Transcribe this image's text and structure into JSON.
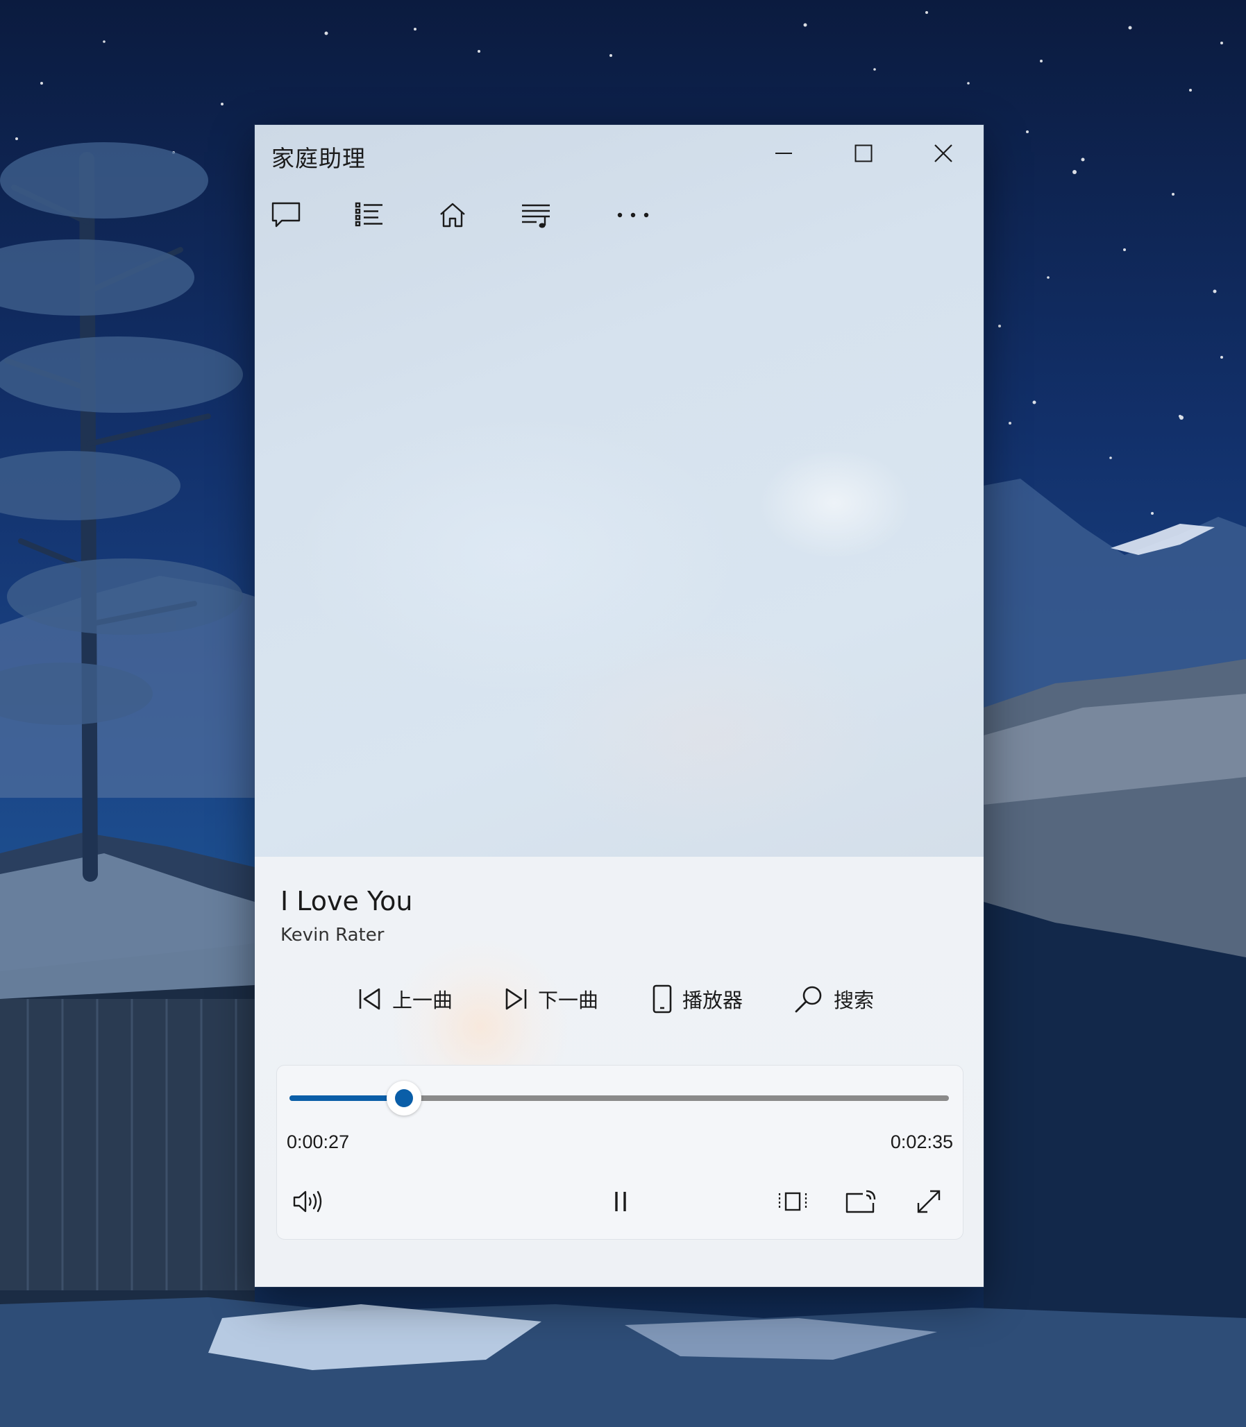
{
  "window": {
    "title": "家庭助理",
    "controls": [
      "minimize-icon",
      "maximize-icon",
      "close-icon"
    ]
  },
  "nav": {
    "items": [
      {
        "icon": "chat-icon"
      },
      {
        "icon": "list-icon"
      },
      {
        "icon": "home-icon"
      },
      {
        "icon": "playlist-icon"
      },
      {
        "icon": "more-icon"
      }
    ]
  },
  "now_playing": {
    "title": "I Love You",
    "artist": "Kevin Rater"
  },
  "actions": {
    "previous": {
      "label": "上一曲",
      "icon": "previous-track-icon"
    },
    "next": {
      "label": "下一曲",
      "icon": "next-track-icon"
    },
    "player": {
      "label": "播放器",
      "icon": "device-icon"
    },
    "search": {
      "label": "搜索",
      "icon": "search-icon"
    }
  },
  "playback": {
    "position": "0:00:27",
    "duration": "0:02:35",
    "progress_fraction": 0.174,
    "state": "playing",
    "controls": [
      "volume-icon",
      "pause-icon",
      "compact-view-icon",
      "cast-icon",
      "fullscreen-icon"
    ]
  },
  "colors": {
    "accent": "#0a5ea8",
    "track": "#8a8a8a",
    "panel": "#eff2f6"
  }
}
